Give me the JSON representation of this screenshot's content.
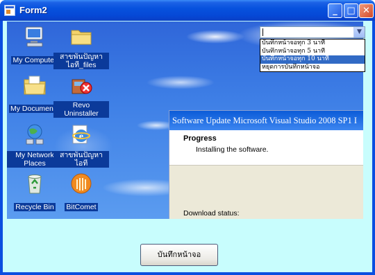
{
  "window": {
    "title": "Form2"
  },
  "title_buttons": {
    "minimize": "_",
    "maximize": "□",
    "close": "✕"
  },
  "dropdown": {
    "value": "",
    "options": [
      "บันทึกหน้าจอทุก 3 นาที",
      "บันทึกหน้าจอทุก 5 นาที",
      "บันทึกหน้าจอทุก 10 นาที",
      "หยุดการบันทึกหน้าจอ"
    ],
    "highlighted_index": 2
  },
  "desktop_icons": [
    {
      "label": "My Computer",
      "icon": "computer-icon"
    },
    {
      "label": "สาขพันปัญหาไอที_files",
      "icon": "folder-icon"
    },
    {
      "label": "My Documents",
      "icon": "documents-folder-icon"
    },
    {
      "label": "Revo Uninstaller",
      "icon": "uninstaller-icon"
    },
    {
      "label": "My Network Places",
      "icon": "network-icon"
    },
    {
      "label": "สาขพันปัญหาไอที",
      "icon": "internet-explorer-icon"
    },
    {
      "label": "Recycle Bin",
      "icon": "recycle-bin-icon"
    },
    {
      "label": "BitComet",
      "icon": "bitcomet-icon"
    }
  ],
  "updater": {
    "title": "Software Update Microsoft Visual Studio 2008 SP1 I",
    "heading": "Progress",
    "subheading": "Installing the software.",
    "status_label": "Download status:"
  },
  "capture_button": {
    "label": "บันทึกหน้าจอ"
  }
}
